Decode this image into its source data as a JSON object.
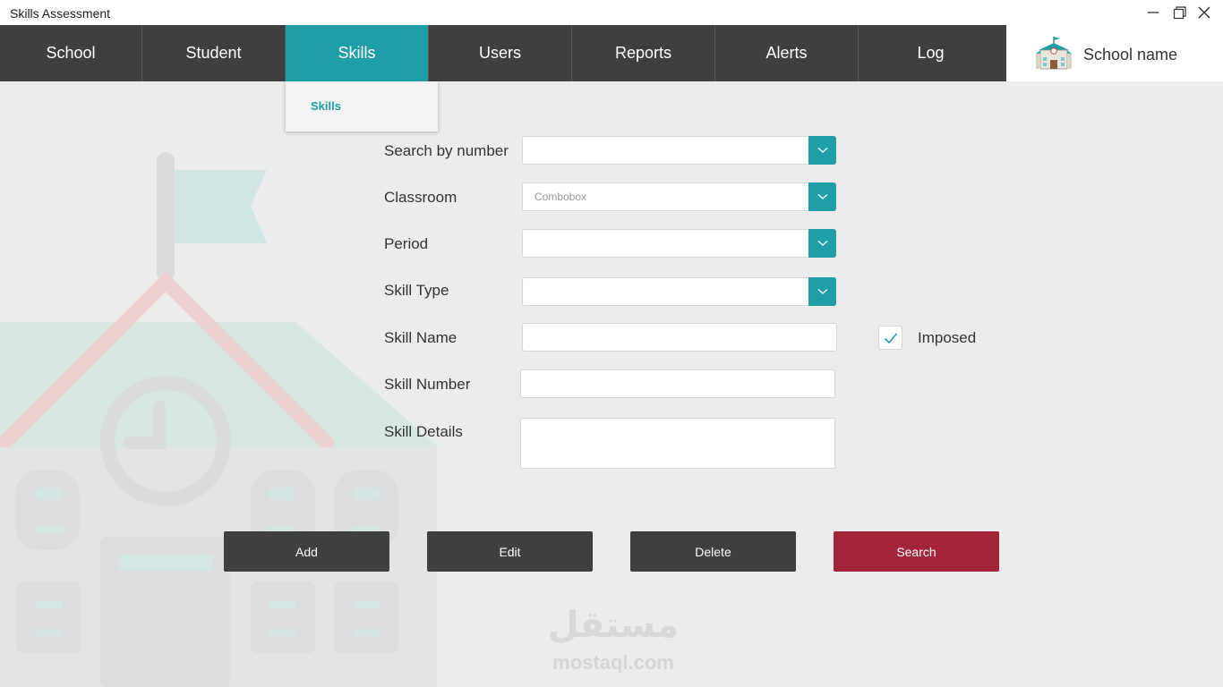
{
  "window": {
    "title": "Skills Assessment",
    "controls": [
      "minimize-icon",
      "maximize-icon",
      "close-icon"
    ]
  },
  "nav": {
    "items": [
      {
        "label": "School"
      },
      {
        "label": "Student"
      },
      {
        "label": "Skills",
        "active": true
      },
      {
        "label": "Users"
      },
      {
        "label": "Reports"
      },
      {
        "label": "Alerts"
      },
      {
        "label": "Log"
      }
    ],
    "accent_color": "#1f9ea5",
    "bar_color": "#3f3f3f"
  },
  "brand": {
    "icon": "school-building-icon",
    "name": "School name"
  },
  "dropdown": {
    "items": [
      {
        "label": "Skills"
      }
    ]
  },
  "form": {
    "search_by_number": {
      "label": "Search by number",
      "value": ""
    },
    "classroom": {
      "label": "Classroom",
      "placeholder": "Combobox"
    },
    "period": {
      "label": "Period",
      "value": ""
    },
    "skill_type": {
      "label": "Skill Type",
      "value": ""
    },
    "skill_name": {
      "label": "Skill Name",
      "value": ""
    },
    "imposed": {
      "label": "Imposed",
      "checked": true
    },
    "skill_number": {
      "label": "Skill Number",
      "value": ""
    },
    "skill_details": {
      "label": "Skill Details",
      "value": ""
    }
  },
  "actions": {
    "add": "Add",
    "edit": "Edit",
    "delete": "Delete",
    "search": "Search",
    "search_color": "#a3253a"
  },
  "watermark": {
    "arabic": "مستقل",
    "latin": "mostaql.com"
  }
}
